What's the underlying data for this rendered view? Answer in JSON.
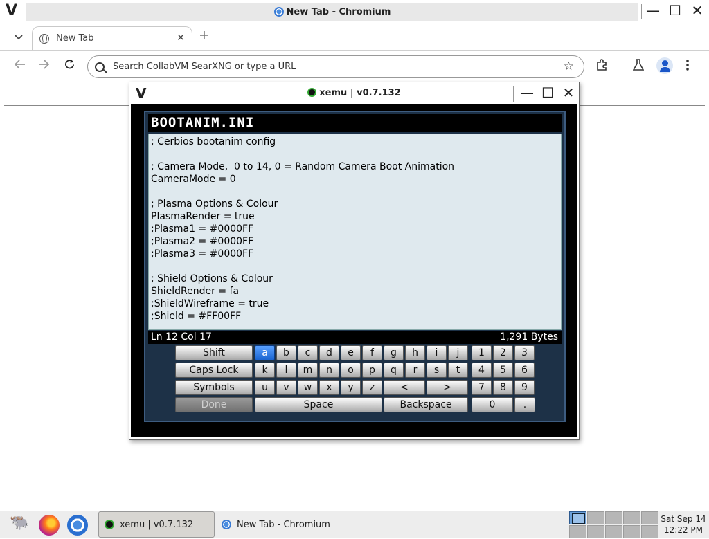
{
  "browser": {
    "window_title": "New Tab - Chromium",
    "tab_label": "New Tab",
    "omnibox_placeholder": "Search CollabVM SearXNG or type a URL"
  },
  "xemu": {
    "window_title": "xemu | v0.7.132",
    "editor_title": "BOOTANIM.INI",
    "editor_text": "; Cerbios bootanim config\n\n; Camera Mode,  0 to 14, 0 = Random Camera Boot Animation\nCameraMode = 0\n\n; Plasma Options & Colour\nPlasmaRender = true\n;Plasma1 = #0000FF\n;Plasma2 = #0000FF\n;Plasma3 = #0000FF\n\n; Shield Options & Colour\nShieldRender = fa\n;ShieldWireframe = true\n;Shield = #FF00FF",
    "status_position": "Ln 12  Col 17",
    "status_size": "1,291 Bytes",
    "keyboard": {
      "shift": "Shift",
      "caps_lock": "Caps Lock",
      "symbols": "Symbols",
      "done": "Done",
      "space": "Space",
      "backspace": "Backspace",
      "left": "<",
      "right": ">",
      "zero": "0",
      "dot": ".",
      "row1": [
        "a",
        "b",
        "c",
        "d",
        "e",
        "f",
        "g",
        "h",
        "i",
        "j"
      ],
      "row2": [
        "k",
        "l",
        "m",
        "n",
        "o",
        "p",
        "q",
        "r",
        "s",
        "t"
      ],
      "row3": [
        "u",
        "v",
        "w",
        "x",
        "y",
        "z"
      ],
      "digits": [
        "1",
        "2",
        "3",
        "4",
        "5",
        "6",
        "7",
        "8",
        "9"
      ],
      "selected_key": "a"
    }
  },
  "taskbar": {
    "xemu_task": "xemu | v0.7.132",
    "chrome_task": "New Tab - Chromium",
    "date": "Sat Sep 14",
    "time": "12:22 PM"
  },
  "icons": {
    "window_logo": "V",
    "minimize": "—",
    "maximize": "☐",
    "close": "✕"
  }
}
